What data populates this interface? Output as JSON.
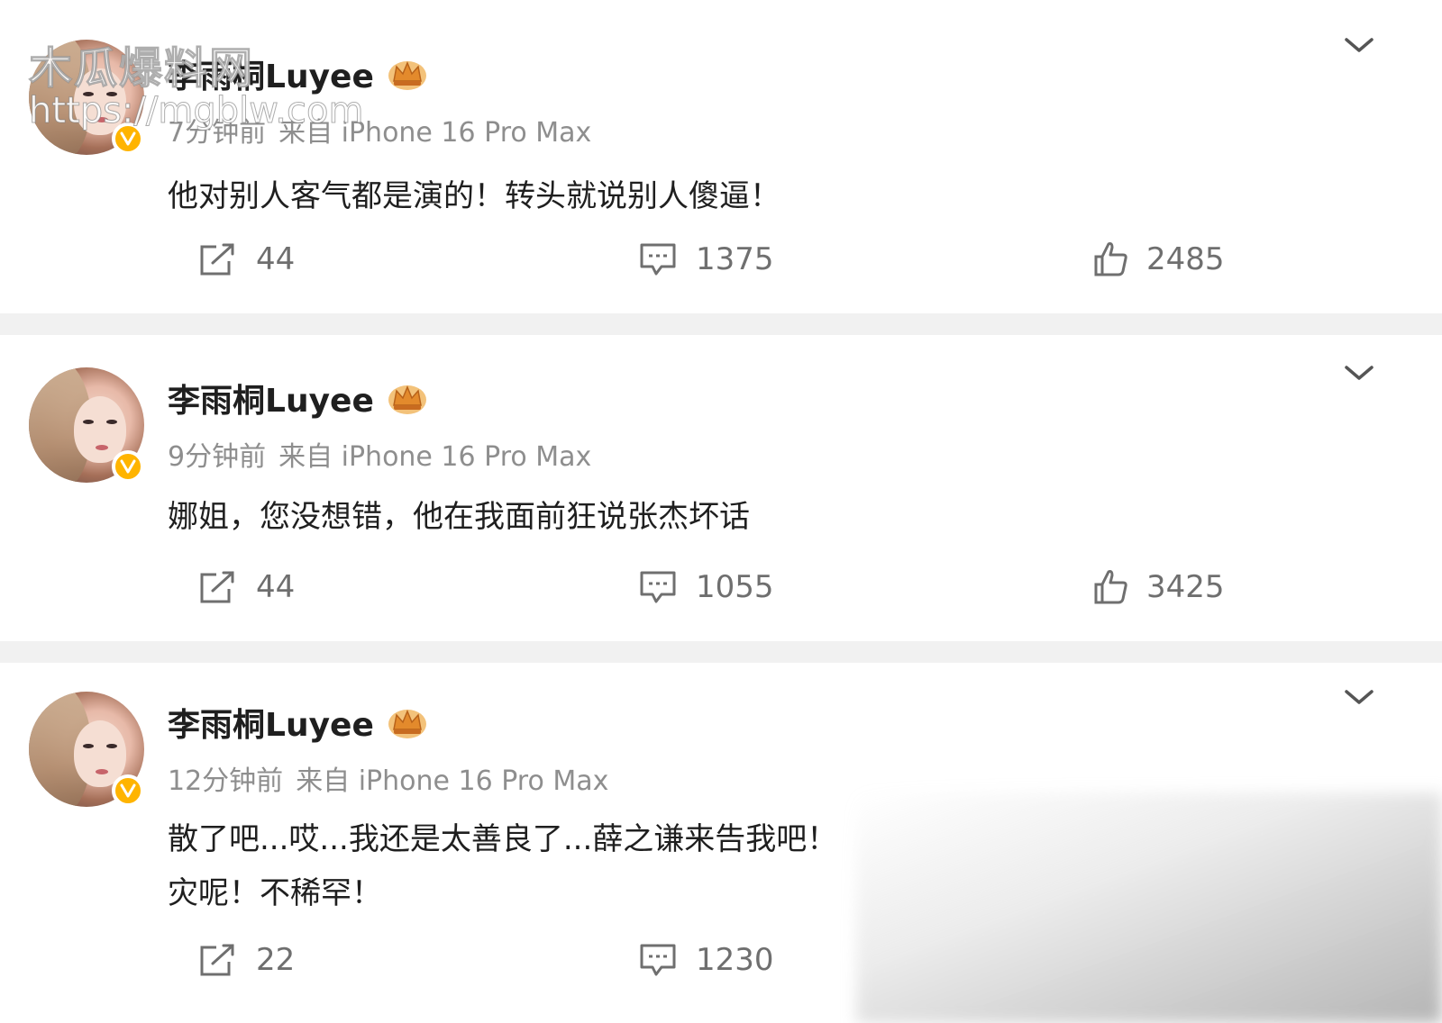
{
  "watermark": {
    "line1": "木瓜爆料网",
    "line2": "https://mgblw.com"
  },
  "colors": {
    "background": "#ffffff",
    "divider": "#f1f1f1",
    "verified": "#ffb400",
    "meta_text": "#8e8e8e",
    "action_text": "#6f6f6f"
  },
  "posts": [
    {
      "username": "李雨桐Luyee",
      "time": "7分钟前",
      "source": "来自 iPhone 16 Pro Max",
      "content_lines": [
        "他对别人客气都是演的！转头就说别人傻逼！"
      ],
      "reposts": "44",
      "comments": "1375",
      "likes": "2485"
    },
    {
      "username": "李雨桐Luyee",
      "time": "9分钟前",
      "source": "来自 iPhone 16 Pro Max",
      "content_lines": [
        "娜姐，您没想错，他在我面前狂说张杰坏话"
      ],
      "reposts": "44",
      "comments": "1055",
      "likes": "3425"
    },
    {
      "username": "李雨桐Luyee",
      "time": "12分钟前",
      "source": "来自 iPhone 16 Pro Max",
      "content_lines": [
        "散了吧...哎...我还是太善良了...薛之谦来告我吧！",
        "灾呢！不稀罕！"
      ],
      "reposts": "22",
      "comments": "1230",
      "likes": ""
    }
  ],
  "icons": {
    "share": "repost-icon",
    "comment": "comment-icon",
    "like": "thumbs-up-icon",
    "more": "chevron-down-icon",
    "verified": "verified-v-icon",
    "member": "crown-icon"
  }
}
